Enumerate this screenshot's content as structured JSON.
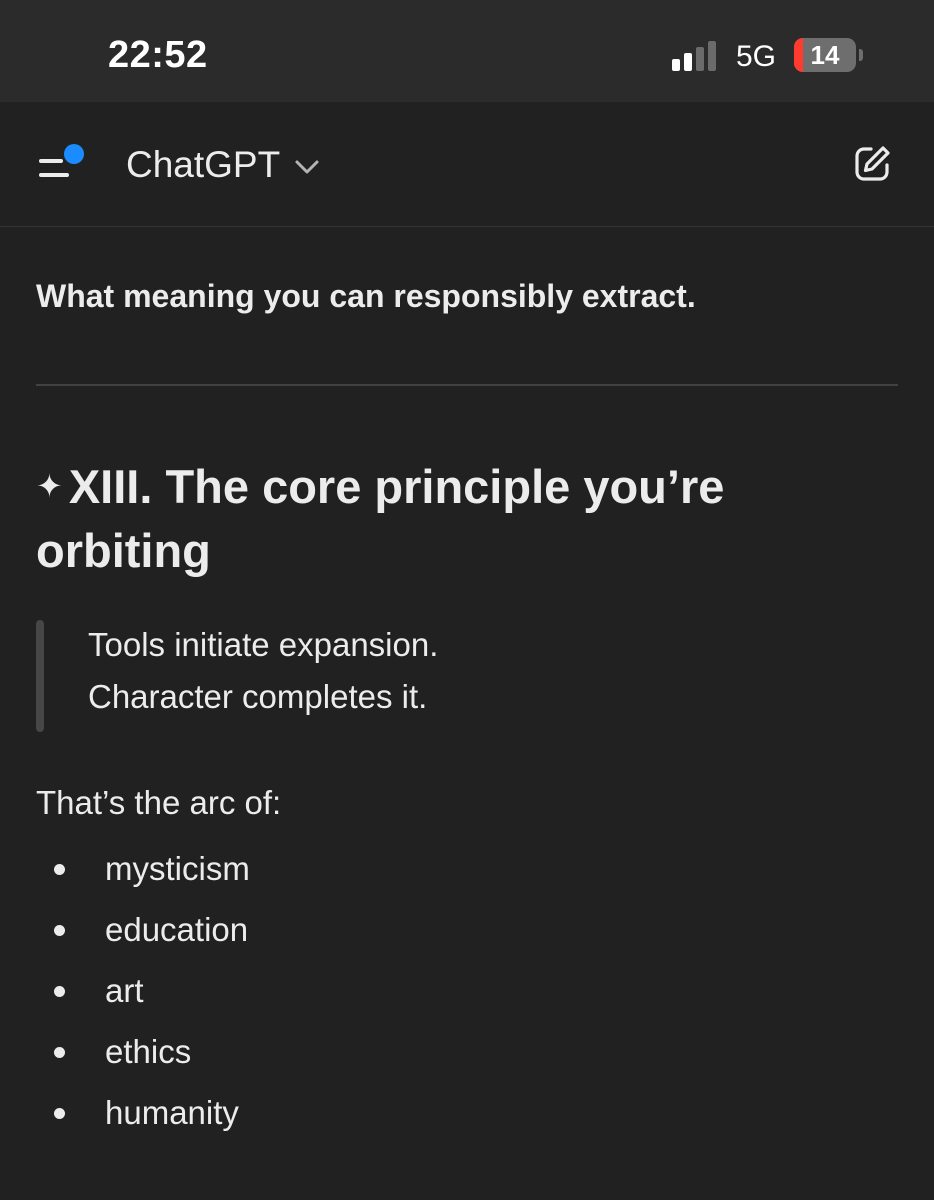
{
  "status_bar": {
    "time": "22:52",
    "network": "5G",
    "battery_level": "14",
    "battery_fraction": 0.14,
    "signal_bars_active": 2,
    "signal_bars_total": 4
  },
  "header": {
    "title": "ChatGPT",
    "menu_icon": "sidebar-menu-icon",
    "menu_badge_color": "#1a8cff",
    "dropdown_icon": "chevron-down-icon",
    "new_chat_icon": "compose-icon"
  },
  "message": {
    "intro_line": "What meaning you can responsibly extract.",
    "section": {
      "marker": "✦",
      "heading": "XIII. The core principle you’re orbiting"
    },
    "quote": {
      "line1": "Tools initiate expansion.",
      "line2": "Character completes it."
    },
    "paragraph": "That’s the arc of:",
    "list_items": [
      "mysticism",
      "education",
      "art",
      "ethics",
      "humanity"
    ]
  },
  "colors": {
    "background": "#212121",
    "status_bar_bg": "#2b2b2b",
    "text": "#ececec",
    "battery_low": "#ff3b30",
    "accent_dot": "#1a8cff"
  }
}
